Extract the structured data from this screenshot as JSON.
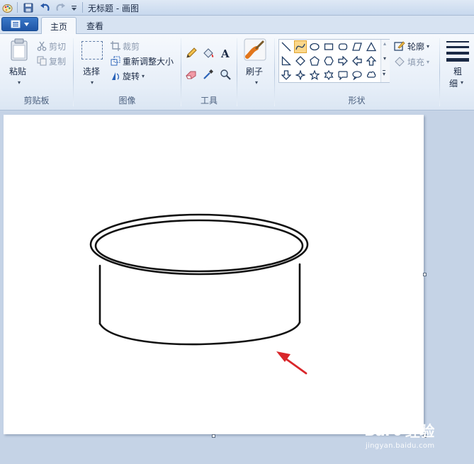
{
  "window": {
    "title": "无标题 - 画图"
  },
  "tabs": [
    {
      "label": "主页"
    },
    {
      "label": "查看"
    }
  ],
  "clipboard": {
    "paste_label": "粘贴",
    "cut_label": "剪切",
    "copy_label": "复制",
    "group_label": "剪贴板"
  },
  "image": {
    "select_label": "选择",
    "crop_label": "裁剪",
    "resize_label": "重新调整大小",
    "rotate_label": "旋转",
    "group_label": "图像"
  },
  "tools": {
    "group_label": "工具",
    "brush_label": "刷子"
  },
  "shapes": {
    "outline_label": "轮廓",
    "fill_label": "填充",
    "group_label": "形状"
  },
  "size": {
    "label_line1": "粗",
    "label_line2": "细"
  },
  "watermark": {
    "logo_left": "Bai",
    "logo_right": "经验",
    "url": "jingyan.baidu.com"
  },
  "colors": {
    "annotation_arrow": "#d9262a",
    "accent": "#2a63b8"
  }
}
